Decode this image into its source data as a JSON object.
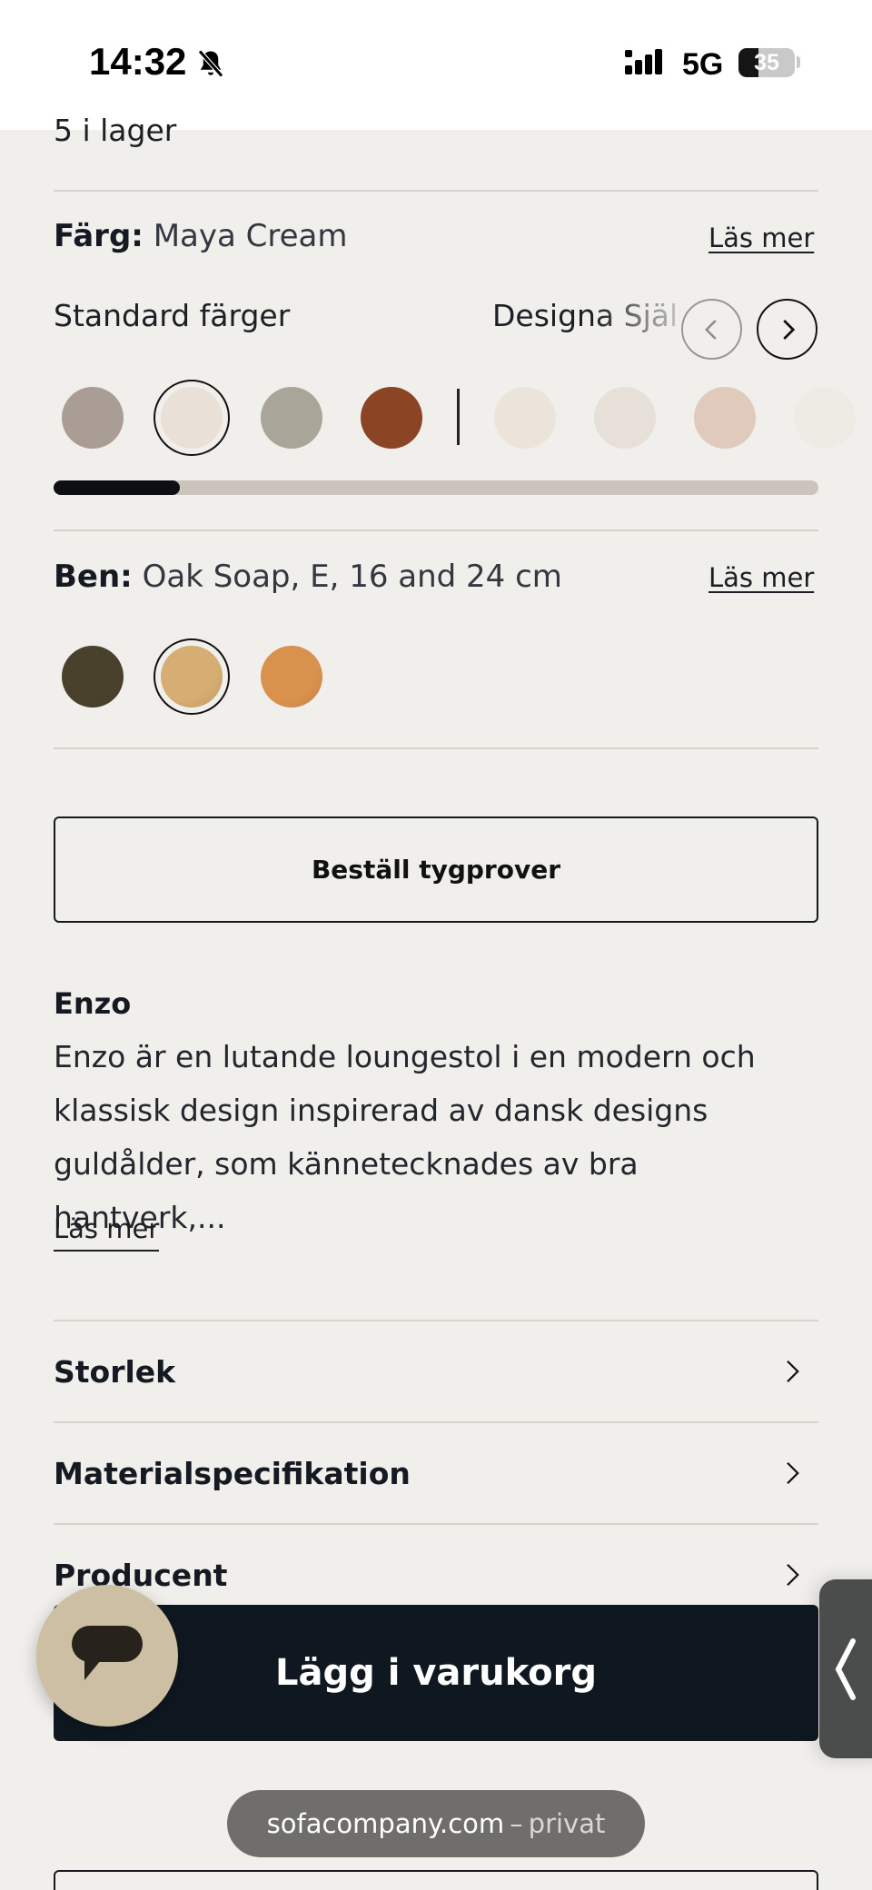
{
  "status_bar": {
    "time": "14:32",
    "network": "5G",
    "battery": "35",
    "battery_level": 0.35
  },
  "stock": {
    "text": "5 i lager"
  },
  "color": {
    "label": "Färg:",
    "value": "Maya Cream",
    "read_more": "Läs mer",
    "standard_label": "Standard färger",
    "design_label": "Designa Själv",
    "swatches": [
      "#aa9d96",
      "#e9e1d7",
      "#aaa599",
      "#8b4525",
      "#ebe4da",
      "#e6e0d8",
      "#e0cabb",
      "#ece6de"
    ],
    "selected_index": 1,
    "scroll_fraction": 0.165,
    "prev_icon": "chevron-left-icon",
    "next_icon": "chevron-right-icon"
  },
  "legs": {
    "label": "Ben:",
    "value": "Oak Soap, E, 16 and 24 cm",
    "read_more": "Läs mer",
    "swatches": [
      "#4a412d",
      "#d6ad72",
      "#d9924d"
    ],
    "selected_index": 1
  },
  "sample_button": {
    "label": "Beställ tygprover"
  },
  "product": {
    "title": "Enzo",
    "description": "Enzo är en lutande loungestol i en modern och klassisk design inspirerad av dansk designs guldålder, som kännetecknades av bra hantverk,...",
    "read_more": "Läs mer"
  },
  "accordion": [
    {
      "label": "Storlek"
    },
    {
      "label": "Materialspecifikation"
    },
    {
      "label": "Producent"
    }
  ],
  "cart_button": {
    "label": "Lägg i varukorg"
  },
  "browser": {
    "domain": "sofacompany.com",
    "separator": "–",
    "mode": "privat"
  },
  "colors": {
    "accent_dark": "#0f1821",
    "chat": "#cdbfa3",
    "background": "#f1efeb"
  }
}
